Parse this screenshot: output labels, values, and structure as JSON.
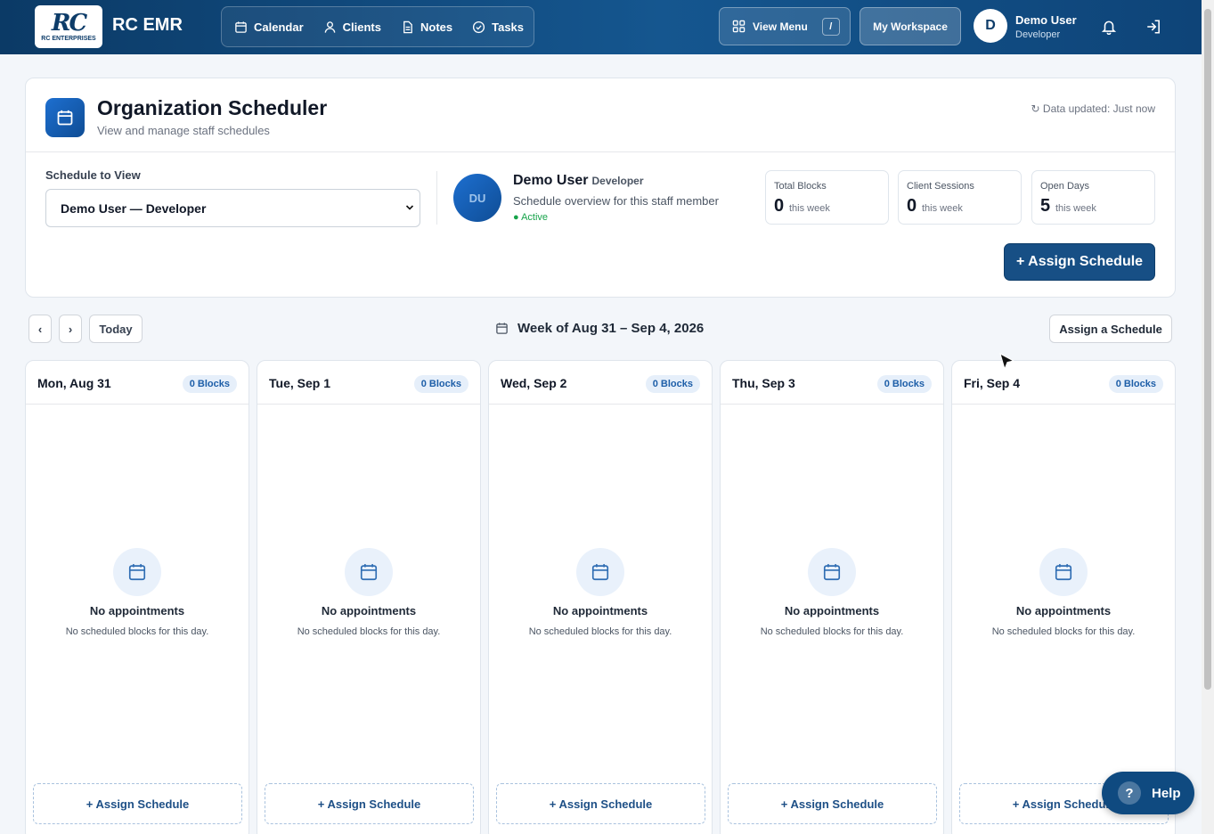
{
  "topbar": {
    "logo_mark": "RC",
    "logo_sub": "RC ENTERPRISES",
    "app_name": "RC EMR",
    "nav": [
      {
        "label": "Calendar",
        "icon": "calendar-icon"
      },
      {
        "label": "Clients",
        "icon": "user-icon"
      },
      {
        "label": "Notes",
        "icon": "document-icon"
      },
      {
        "label": "Tasks",
        "icon": "check-circle-icon"
      }
    ],
    "view_menu_label": "View Menu",
    "view_menu_shortcut": "/",
    "workspace_label": "My Workspace",
    "user": {
      "initial": "D",
      "name": "Demo User",
      "role": "Developer"
    }
  },
  "header": {
    "title": "Organization Scheduler",
    "subtitle": "View and manage staff schedules",
    "updated": "↻ Data updated: Just now",
    "schedule_label": "Schedule to View",
    "schedule_selected": "Demo User — Developer",
    "staff": {
      "initials": "DU",
      "name": "Demo User",
      "role": "Developer",
      "description": "Schedule overview for this staff member",
      "status": "● Active"
    },
    "stats": [
      {
        "label": "Total Blocks",
        "value": "0",
        "unit": "this week"
      },
      {
        "label": "Client Sessions",
        "value": "0",
        "unit": "this week"
      },
      {
        "label": "Open Days",
        "value": "5",
        "unit": "this week"
      }
    ],
    "assign_button": "+ Assign Schedule"
  },
  "week": {
    "prev": "‹",
    "next": "›",
    "today": "Today",
    "label": "Week of Aug 31 – Sep 4, 2026",
    "assign_button": "Assign a Schedule"
  },
  "days": [
    {
      "title": "Mon, Aug 31",
      "badge": "0 Blocks"
    },
    {
      "title": "Tue, Sep 1",
      "badge": "0 Blocks"
    },
    {
      "title": "Wed, Sep 2",
      "badge": "0 Blocks"
    },
    {
      "title": "Thu, Sep 3",
      "badge": "0 Blocks"
    },
    {
      "title": "Fri, Sep 4",
      "badge": "0 Blocks"
    }
  ],
  "empty": {
    "title": "No appointments",
    "subtitle": "No scheduled blocks for this day.",
    "assign": "+ Assign Schedule"
  },
  "help": {
    "icon": "?",
    "label": "Help"
  },
  "colors": {
    "brand": "#0d3c69",
    "accent": "#174f85",
    "active": "#16a34a"
  }
}
